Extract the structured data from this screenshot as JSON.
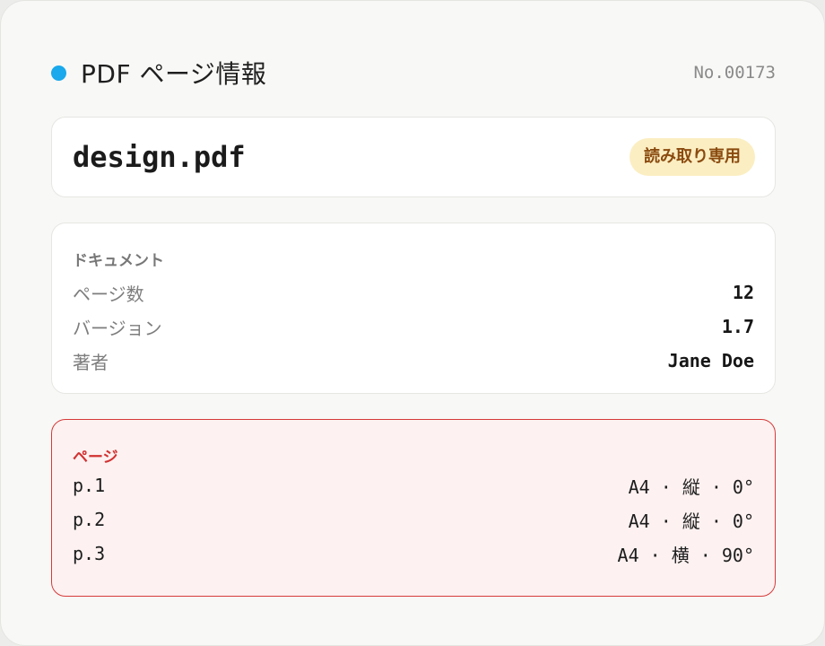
{
  "header": {
    "title": "PDF ページ情報",
    "doc_number": "No.00173",
    "status_dot_color": "#19a9ec"
  },
  "file": {
    "name": "design.pdf",
    "badge": "読み取り専用"
  },
  "document": {
    "section_title": "ドキュメント",
    "rows": [
      {
        "label": "ページ数",
        "value": "12"
      },
      {
        "label": "バージョン",
        "value": "1.7"
      },
      {
        "label": "著者",
        "value": "Jane Doe"
      }
    ]
  },
  "pages": {
    "section_title": "ページ",
    "accent_color": "#d63a3a",
    "rows": [
      {
        "label": "p.1",
        "value": "A4 · 縦 · 0°"
      },
      {
        "label": "p.2",
        "value": "A4 · 縦 · 0°"
      },
      {
        "label": "p.3",
        "value": "A4 · 横 · 90°"
      }
    ]
  }
}
